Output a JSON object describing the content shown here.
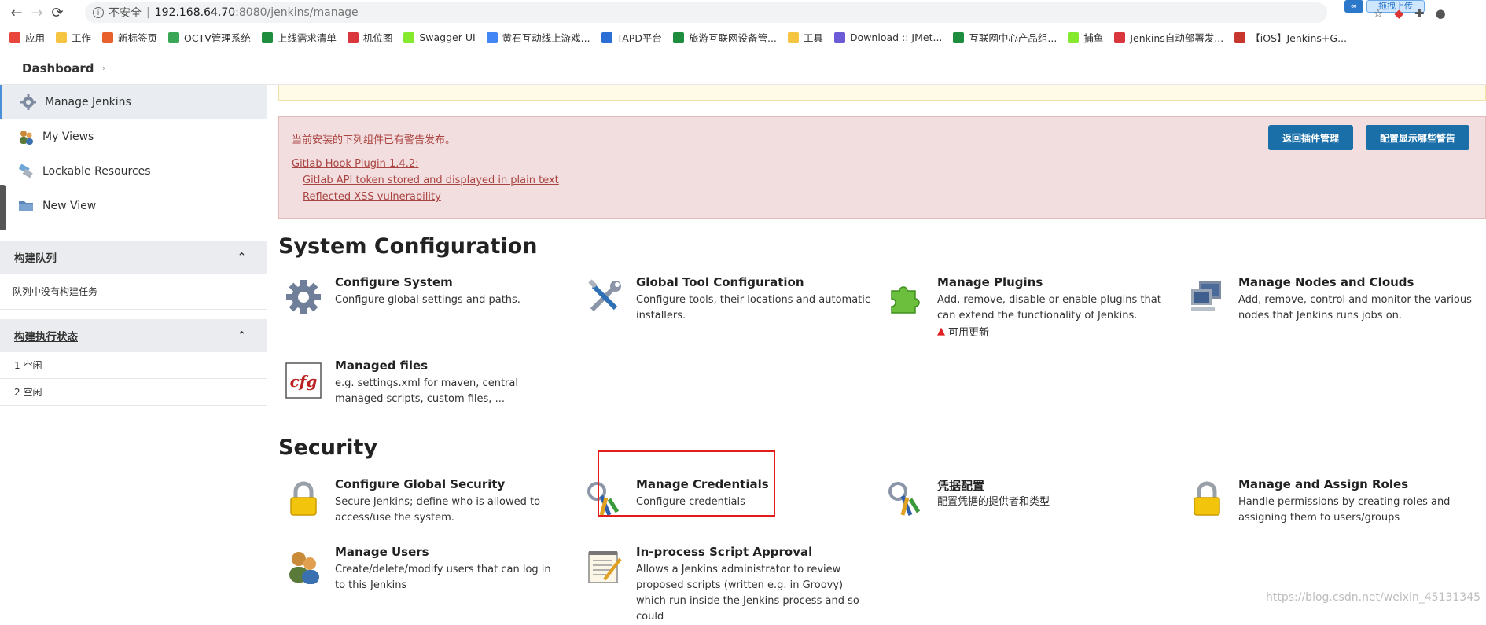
{
  "browser": {
    "back": "←",
    "forward": "→",
    "reload": "⟳",
    "insecure_label": "不安全",
    "url_host": "192.168.64.70",
    "url_path": ":8080/jenkins/manage",
    "upload_label": "拖拽上传",
    "bookmarks": [
      {
        "label": "应用",
        "color": "#e8453c"
      },
      {
        "label": "工作",
        "color": "#f5c542"
      },
      {
        "label": "新标签页",
        "color": "#e8602c"
      },
      {
        "label": "OCTV管理系统",
        "color": "#3aa757"
      },
      {
        "label": "上线需求清单",
        "color": "#1e8e3e"
      },
      {
        "label": "机位图",
        "color": "#d9363e"
      },
      {
        "label": "Swagger UI",
        "color": "#85ea2d"
      },
      {
        "label": "黄石互动线上游戏...",
        "color": "#4285f4"
      },
      {
        "label": "TAPD平台",
        "color": "#2b6fd6"
      },
      {
        "label": "旅游互联网设备管...",
        "color": "#1e8e3e"
      },
      {
        "label": "工具",
        "color": "#f5c542"
      },
      {
        "label": "Download :: JMet...",
        "color": "#6b5bd6"
      },
      {
        "label": "互联网中心产品组...",
        "color": "#1e8e3e"
      },
      {
        "label": "捕鱼",
        "color": "#85ea2d"
      },
      {
        "label": "Jenkins自动部署发...",
        "color": "#d9363e"
      },
      {
        "label": "【iOS】Jenkins+G...",
        "color": "#c7362c"
      }
    ]
  },
  "header": {
    "breadcrumb": "Dashboard",
    "sep": "›"
  },
  "sidebar": {
    "items": [
      {
        "label": "Manage Jenkins",
        "icon": "gear-icon"
      },
      {
        "label": "My Views",
        "icon": "people-icon"
      },
      {
        "label": "Lockable Resources",
        "icon": "usb-icon"
      },
      {
        "label": "New View",
        "icon": "folder-icon"
      }
    ],
    "build_queue": {
      "title": "构建队列",
      "empty": "队列中没有构建任务",
      "toggle": "⌃"
    },
    "executors": {
      "title": "构建执行状态",
      "toggle": "⌃",
      "rows": [
        "1  空闲",
        "2  空闲"
      ]
    }
  },
  "alert": {
    "title": "当前安装的下列组件已有警告发布。",
    "plugin": "Gitlab Hook Plugin 1.4.2",
    "plugin_suffix": ":",
    "warnings": [
      "Gitlab API token stored and displayed in plain text",
      "Reflected XSS vulnerability"
    ],
    "btn_plugins": "返回插件管理",
    "btn_configure": "配置显示哪些警告"
  },
  "system_configuration": {
    "title": "System Configuration",
    "cards": [
      {
        "title": "Configure System",
        "desc": "Configure global settings and paths."
      },
      {
        "title": "Global Tool Configuration",
        "desc": "Configure tools, their locations and automatic installers."
      },
      {
        "title": "Manage Plugins",
        "desc": "Add, remove, disable or enable plugins that can extend the functionality of Jenkins.",
        "note": "可用更新"
      },
      {
        "title": "Manage Nodes and Clouds",
        "desc": "Add, remove, control and monitor the various nodes that Jenkins runs jobs on."
      },
      {
        "title": "Managed files",
        "desc": "e.g. settings.xml for maven, central managed scripts, custom files, ..."
      }
    ]
  },
  "security": {
    "title": "Security",
    "cards": [
      {
        "title": "Configure Global Security",
        "desc": "Secure Jenkins; define who is allowed to access/use the system."
      },
      {
        "title": "Manage Credentials",
        "desc": "Configure credentials"
      },
      {
        "title": "凭据配置",
        "desc": "配置凭据的提供者和类型"
      },
      {
        "title": "Manage and Assign Roles",
        "desc": "Handle permissions by creating roles and assigning them to users/groups"
      },
      {
        "title": "Manage Users",
        "desc": "Create/delete/modify users that can log in to this Jenkins"
      },
      {
        "title": "In-process Script Approval",
        "desc": "Allows a Jenkins administrator to review proposed scripts (written e.g. in Groovy) which run inside the Jenkins process and so could"
      }
    ]
  },
  "watermark": "https://blog.csdn.net/weixin_45131345"
}
